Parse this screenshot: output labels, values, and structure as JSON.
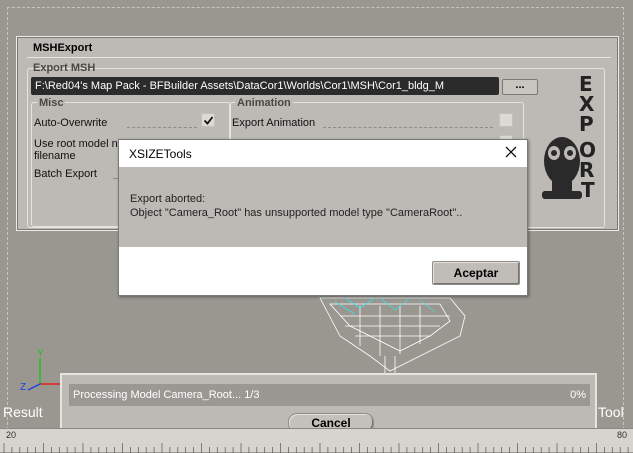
{
  "msh_panel": {
    "title": "MSHExport",
    "export_group_label": "Export MSH",
    "path_value": "F:\\Red04's Map Pack - BFBuilder Assets\\DataCor1\\Worlds\\Cor1\\MSH\\Cor1_bldg_M",
    "browse_label": "...",
    "misc": {
      "label": "Misc",
      "auto_overwrite": "Auto-Overwrite",
      "root_model_line1": "Use root model na",
      "root_model_line2": "filename",
      "batch_export": "Batch Export"
    },
    "animation": {
      "label": "Animation",
      "export_animation": "Export Animation"
    },
    "logo_text": "EXPORT"
  },
  "dialog": {
    "title": "XSIZETools",
    "message_line1": "Export aborted:",
    "message_line2": "Object \"Camera_Root\" has unsupported model type \"CameraRoot\"..",
    "accept_label": "Aceptar"
  },
  "progress": {
    "text": "Processing Model Camera_Root... 1/3",
    "percent": "0%",
    "value": 0,
    "cancel_label": "Cancel"
  },
  "viewport": {
    "result_label": "Result",
    "tool_label": "Tool",
    "axis_x": "X",
    "axis_y": "Y",
    "axis_z": "Z"
  },
  "ruler": {
    "left_value": "20",
    "right_value": "80"
  },
  "colors": {
    "panel_bg": "#bdbab5",
    "path_field_bg": "#2b2b2b",
    "axis_x": "#e02020",
    "axis_y": "#20c020",
    "axis_z": "#2040e0",
    "wireframe": "#ffffff",
    "wireframe_accent": "#40e0e0"
  }
}
